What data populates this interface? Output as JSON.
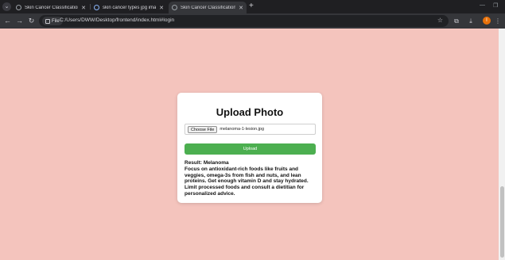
{
  "browser": {
    "tabs": [
      {
        "title": "Skin Cancer Classification",
        "active": false
      },
      {
        "title": "skin cancer types jpg images - ...",
        "active": false
      },
      {
        "title": "Skin Cancer Classification",
        "active": true
      }
    ],
    "site_label": "File",
    "url": "C:/Users/DWW/Desktop/frontend/index.html#login",
    "profile_initial": "I"
  },
  "card": {
    "title": "Upload Photo",
    "choose_label": "Choose File",
    "file_name": "melanoma-1-lesion.jpg",
    "upload_label": "Upload",
    "result_title": "Result: Melanoma",
    "result_text": "Focus on antioxidant-rich foods like fruits and veggies, omega-3s from fish and nuts, and lean proteins. Get enough vitamin D and stay hydrated. Limit processed foods and consult a dietitian for personalized advice."
  },
  "colors": {
    "page_bg": "#f4c4bd",
    "upload_button": "#4caf50"
  }
}
